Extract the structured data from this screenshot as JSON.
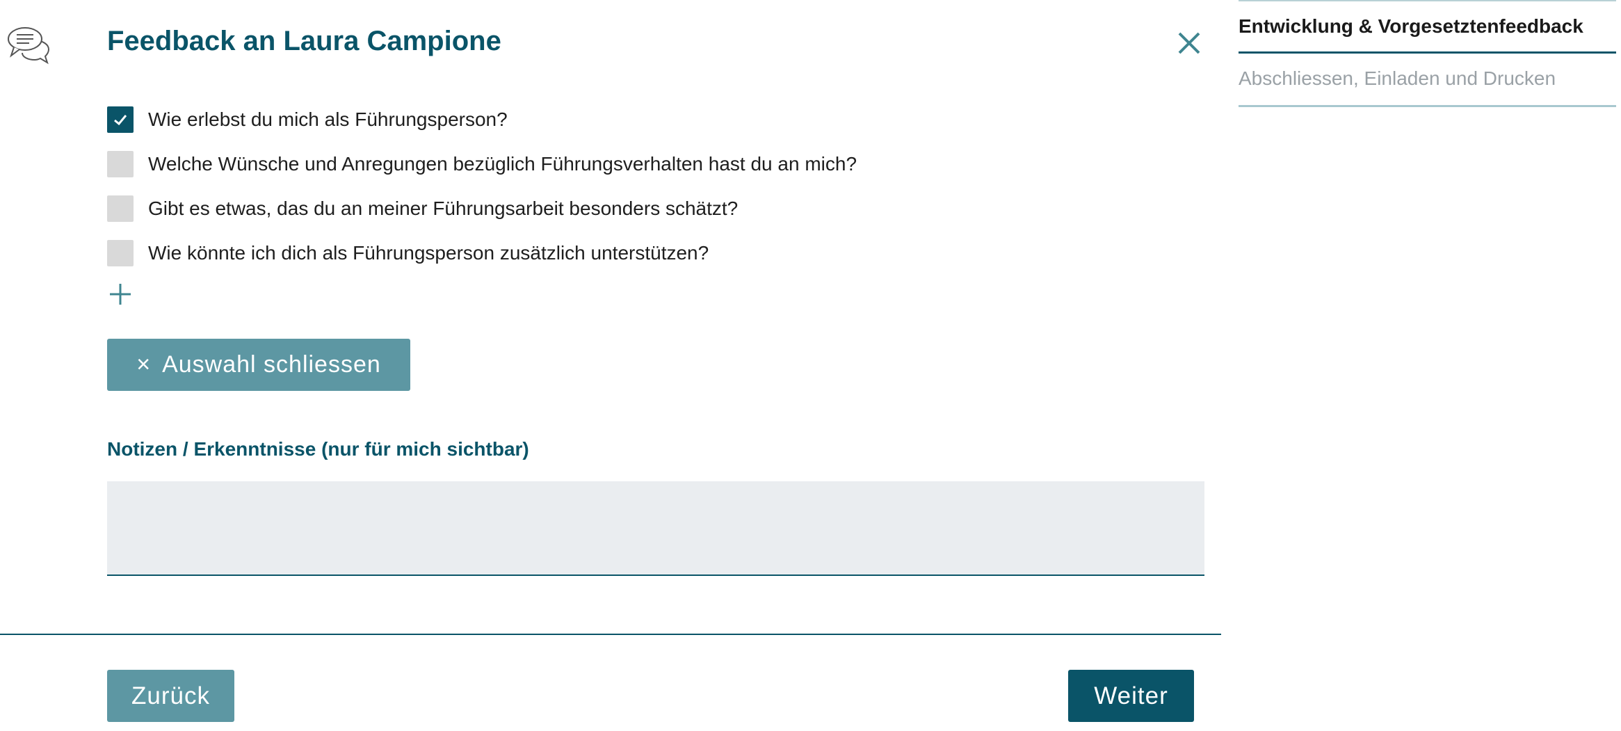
{
  "header": {
    "title": "Feedback an Laura Campione",
    "chat_icon": "chat-bubbles-icon",
    "close_icon": "close-icon"
  },
  "questions": [
    {
      "label": "Wie erlebst du mich als Führungsperson?",
      "checked": true
    },
    {
      "label": "Welche Wünsche und Anregungen bezüglich Führungsverhalten hast du an mich?",
      "checked": false
    },
    {
      "label": "Gibt es etwas, das du an meiner Führungsarbeit besonders schätzt?",
      "checked": false
    },
    {
      "label": "Wie könnte ich dich als Führungsperson zusätzlich unterstützen?",
      "checked": false
    }
  ],
  "add_icon": "plus-icon",
  "close_selection": {
    "label": "Auswahl schliessen",
    "icon": "×"
  },
  "notes": {
    "label": "Notizen / Erkenntnisse (nur für mich sichtbar)",
    "value": ""
  },
  "footer": {
    "back_label": "Zurück",
    "next_label": "Weiter"
  },
  "steps": [
    {
      "label": "Entwicklung & Vorgesetztenfeedback",
      "active": true
    },
    {
      "label": "Abschliessen, Einladen und Drucken",
      "active": false
    }
  ],
  "colors": {
    "primary": "#0a5468",
    "secondary": "#5d97a3",
    "checkbox_off": "#d9d9d9",
    "notes_bg": "#eaedf0"
  }
}
